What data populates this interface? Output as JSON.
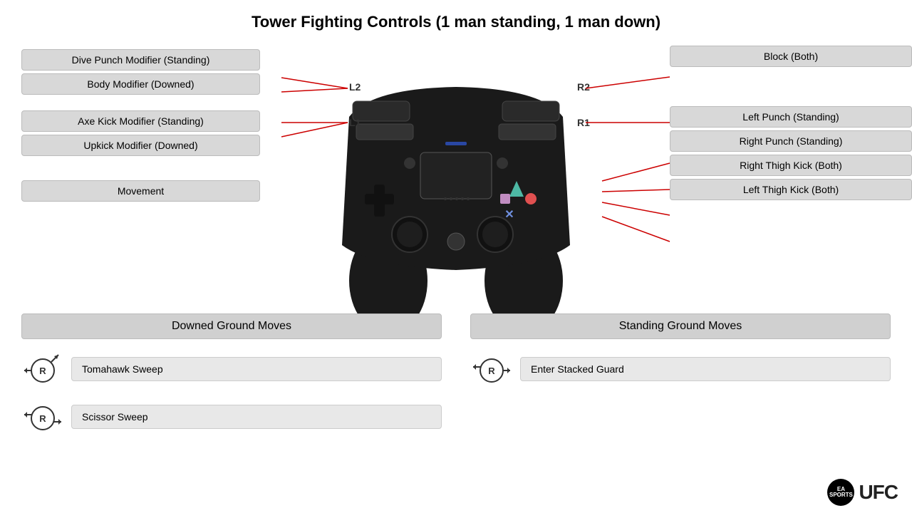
{
  "title": "Tower Fighting Controls (1 man standing, 1 man down)",
  "left_labels": {
    "group1": [
      "Dive Punch Modifier (Standing)",
      "Body Modifier (Downed)"
    ],
    "group2": [
      "Axe Kick Modifier (Standing)",
      "Upkick Modifier (Downed)"
    ],
    "movement": "Movement"
  },
  "right_labels": {
    "block": "Block (Both)",
    "left_punch": "Left Punch (Standing)",
    "right_punch": "Right Punch (Standing)",
    "right_thigh": "Right Thigh Kick (Both)",
    "left_thigh": "Left Thigh Kick (Both)"
  },
  "triggers": {
    "l2": "L2",
    "l1": "L1",
    "r2": "R2",
    "r1": "R1"
  },
  "bottom": {
    "downed_title": "Downed Ground Moves",
    "standing_title": "Standing Ground Moves",
    "downed_moves": [
      "Tomahawk Sweep",
      "Scissor Sweep"
    ],
    "standing_moves": [
      "Enter Stacked Guard"
    ]
  },
  "logo": {
    "ea": "EA\nSPORTS",
    "ufc": "UFC"
  }
}
